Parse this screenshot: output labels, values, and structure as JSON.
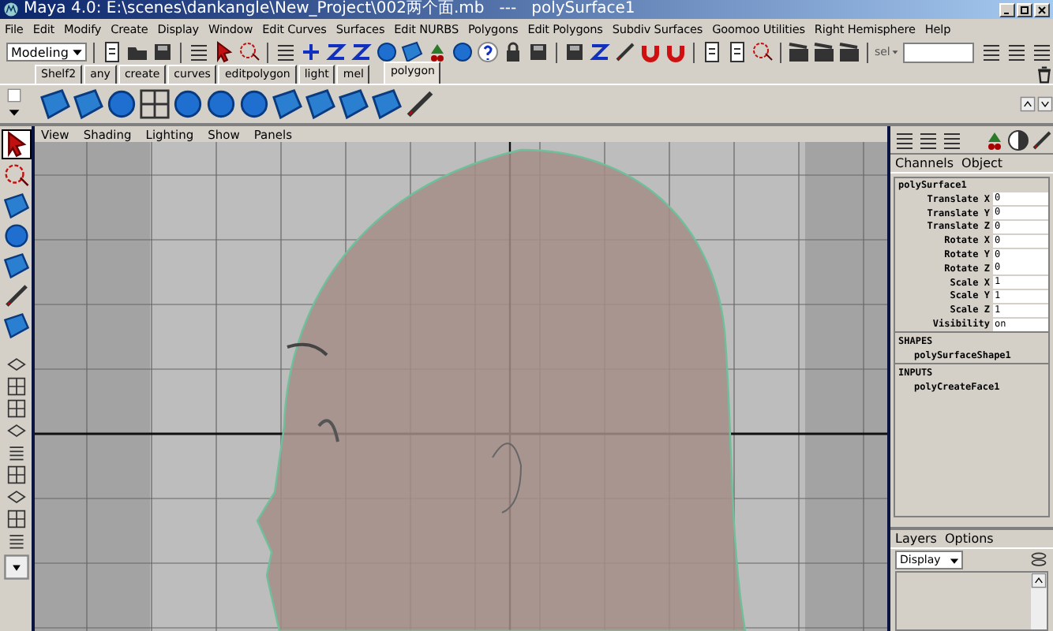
{
  "window": {
    "title": "Maya 4.0: E:\\scenes\\dankangle\\New_Project\\002两个面.mb   ---   polySurface1"
  },
  "menu": [
    "File",
    "Edit",
    "Modify",
    "Create",
    "Display",
    "Window",
    "Edit Curves",
    "Surfaces",
    "Edit NURBS",
    "Polygons",
    "Edit Polygons",
    "Subdiv Surfaces",
    "Goomoo Utilities",
    "Right Hemisphere",
    "Help"
  ],
  "status_line": {
    "mode": "Modeling",
    "selection_label": "sel"
  },
  "shelf_tabs": [
    {
      "label": "Shelf2",
      "selected": false
    },
    {
      "label": "any",
      "selected": false
    },
    {
      "label": "create",
      "selected": false
    },
    {
      "label": "curves",
      "selected": false
    },
    {
      "label": "editpolygon",
      "selected": false
    },
    {
      "label": "light",
      "selected": false
    },
    {
      "label": "mel",
      "selected": false
    },
    {
      "label": "polygon",
      "selected": true
    }
  ],
  "viewport": {
    "menu": [
      "View",
      "Shading",
      "Lighting",
      "Show",
      "Panels"
    ]
  },
  "channel_box": {
    "menu": [
      "Channels",
      "Object"
    ],
    "object": "polySurface1",
    "channels": [
      {
        "name": "Translate X",
        "value": "0"
      },
      {
        "name": "Translate Y",
        "value": "0"
      },
      {
        "name": "Translate Z",
        "value": "0"
      },
      {
        "name": "Rotate X",
        "value": "0"
      },
      {
        "name": "Rotate Y",
        "value": "0"
      },
      {
        "name": "Rotate Z",
        "value": "0"
      },
      {
        "name": "Scale X",
        "value": "1"
      },
      {
        "name": "Scale Y",
        "value": "1"
      },
      {
        "name": "Scale Z",
        "value": "1"
      },
      {
        "name": "Visibility",
        "value": "on"
      }
    ],
    "shapes_header": "SHAPES",
    "shapes": [
      "polySurfaceShape1"
    ],
    "inputs_header": "INPUTS",
    "inputs": [
      "polyCreateFace1"
    ]
  },
  "layers": {
    "menu": [
      "Layers",
      "Options"
    ],
    "display": "Display"
  }
}
